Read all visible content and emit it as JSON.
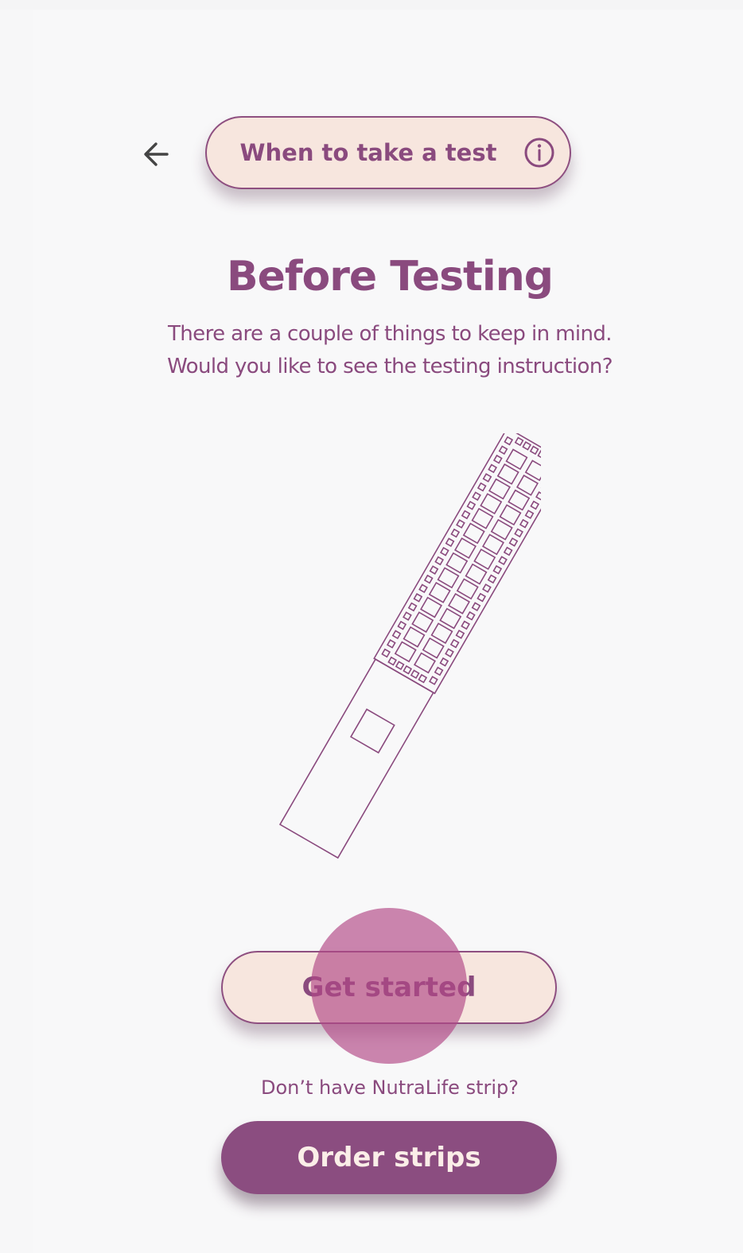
{
  "header": {
    "back_icon": "arrow-left-icon",
    "info_button_label": "When to take a test",
    "info_icon": "info-icon"
  },
  "main": {
    "title": "Before Testing",
    "subtitle": "There are a couple of things to keep in mind. Would you like to see the testing instruction?",
    "illustration": "test-strip-illustration"
  },
  "actions": {
    "get_started_label": "Get started",
    "no_strip_text": "Don’t have NutraLife strip?",
    "order_label": "Order strips"
  },
  "colors": {
    "accent": "#8a4a7e",
    "pill_fill": "#f7e6de",
    "order_fill": "#8b4d80",
    "touch_indicator": "#b14785"
  }
}
